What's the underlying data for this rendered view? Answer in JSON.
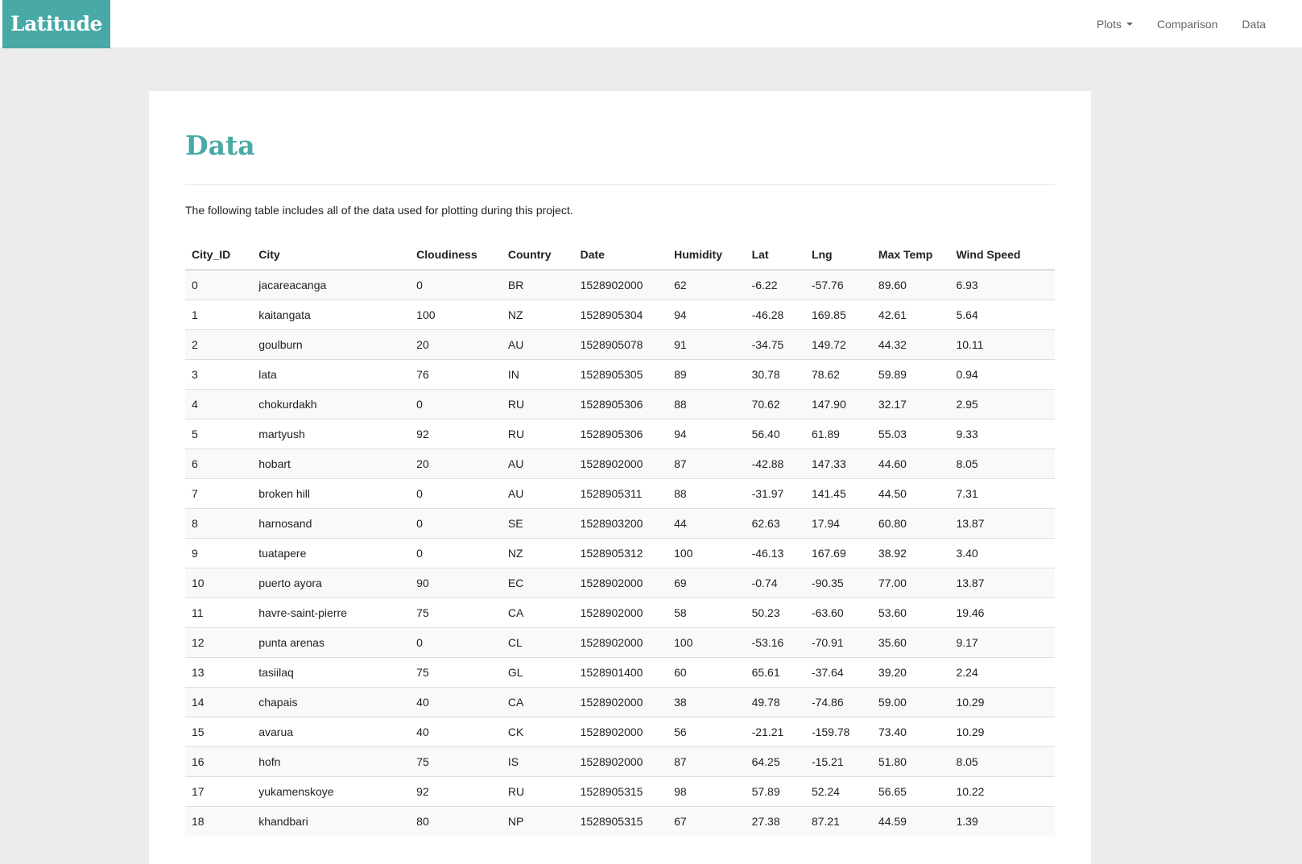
{
  "navbar": {
    "brand": "Latitude",
    "links": [
      {
        "label": "Plots",
        "dropdown": true
      },
      {
        "label": "Comparison",
        "dropdown": false
      },
      {
        "label": "Data",
        "dropdown": false
      }
    ]
  },
  "page": {
    "title": "Data",
    "intro": "The following table includes all of the data used for plotting during this project."
  },
  "colors": {
    "brand": "#48a9a6",
    "background": "#ececec"
  },
  "table": {
    "columns": [
      "City_ID",
      "City",
      "Cloudiness",
      "Country",
      "Date",
      "Humidity",
      "Lat",
      "Lng",
      "Max Temp",
      "Wind Speed"
    ],
    "rows": [
      [
        "0",
        "jacareacanga",
        "0",
        "BR",
        "1528902000",
        "62",
        "-6.22",
        "-57.76",
        "89.60",
        "6.93"
      ],
      [
        "1",
        "kaitangata",
        "100",
        "NZ",
        "1528905304",
        "94",
        "-46.28",
        "169.85",
        "42.61",
        "5.64"
      ],
      [
        "2",
        "goulburn",
        "20",
        "AU",
        "1528905078",
        "91",
        "-34.75",
        "149.72",
        "44.32",
        "10.11"
      ],
      [
        "3",
        "lata",
        "76",
        "IN",
        "1528905305",
        "89",
        "30.78",
        "78.62",
        "59.89",
        "0.94"
      ],
      [
        "4",
        "chokurdakh",
        "0",
        "RU",
        "1528905306",
        "88",
        "70.62",
        "147.90",
        "32.17",
        "2.95"
      ],
      [
        "5",
        "martyush",
        "92",
        "RU",
        "1528905306",
        "94",
        "56.40",
        "61.89",
        "55.03",
        "9.33"
      ],
      [
        "6",
        "hobart",
        "20",
        "AU",
        "1528902000",
        "87",
        "-42.88",
        "147.33",
        "44.60",
        "8.05"
      ],
      [
        "7",
        "broken hill",
        "0",
        "AU",
        "1528905311",
        "88",
        "-31.97",
        "141.45",
        "44.50",
        "7.31"
      ],
      [
        "8",
        "harnosand",
        "0",
        "SE",
        "1528903200",
        "44",
        "62.63",
        "17.94",
        "60.80",
        "13.87"
      ],
      [
        "9",
        "tuatapere",
        "0",
        "NZ",
        "1528905312",
        "100",
        "-46.13",
        "167.69",
        "38.92",
        "3.40"
      ],
      [
        "10",
        "puerto ayora",
        "90",
        "EC",
        "1528902000",
        "69",
        "-0.74",
        "-90.35",
        "77.00",
        "13.87"
      ],
      [
        "11",
        "havre-saint-pierre",
        "75",
        "CA",
        "1528902000",
        "58",
        "50.23",
        "-63.60",
        "53.60",
        "19.46"
      ],
      [
        "12",
        "punta arenas",
        "0",
        "CL",
        "1528902000",
        "100",
        "-53.16",
        "-70.91",
        "35.60",
        "9.17"
      ],
      [
        "13",
        "tasiilaq",
        "75",
        "GL",
        "1528901400",
        "60",
        "65.61",
        "-37.64",
        "39.20",
        "2.24"
      ],
      [
        "14",
        "chapais",
        "40",
        "CA",
        "1528902000",
        "38",
        "49.78",
        "-74.86",
        "59.00",
        "10.29"
      ],
      [
        "15",
        "avarua",
        "40",
        "CK",
        "1528902000",
        "56",
        "-21.21",
        "-159.78",
        "73.40",
        "10.29"
      ],
      [
        "16",
        "hofn",
        "75",
        "IS",
        "1528902000",
        "87",
        "64.25",
        "-15.21",
        "51.80",
        "8.05"
      ],
      [
        "17",
        "yukamenskoye",
        "92",
        "RU",
        "1528905315",
        "98",
        "57.89",
        "52.24",
        "56.65",
        "10.22"
      ],
      [
        "18",
        "khandbari",
        "80",
        "NP",
        "1528905315",
        "67",
        "27.38",
        "87.21",
        "44.59",
        "1.39"
      ]
    ]
  }
}
